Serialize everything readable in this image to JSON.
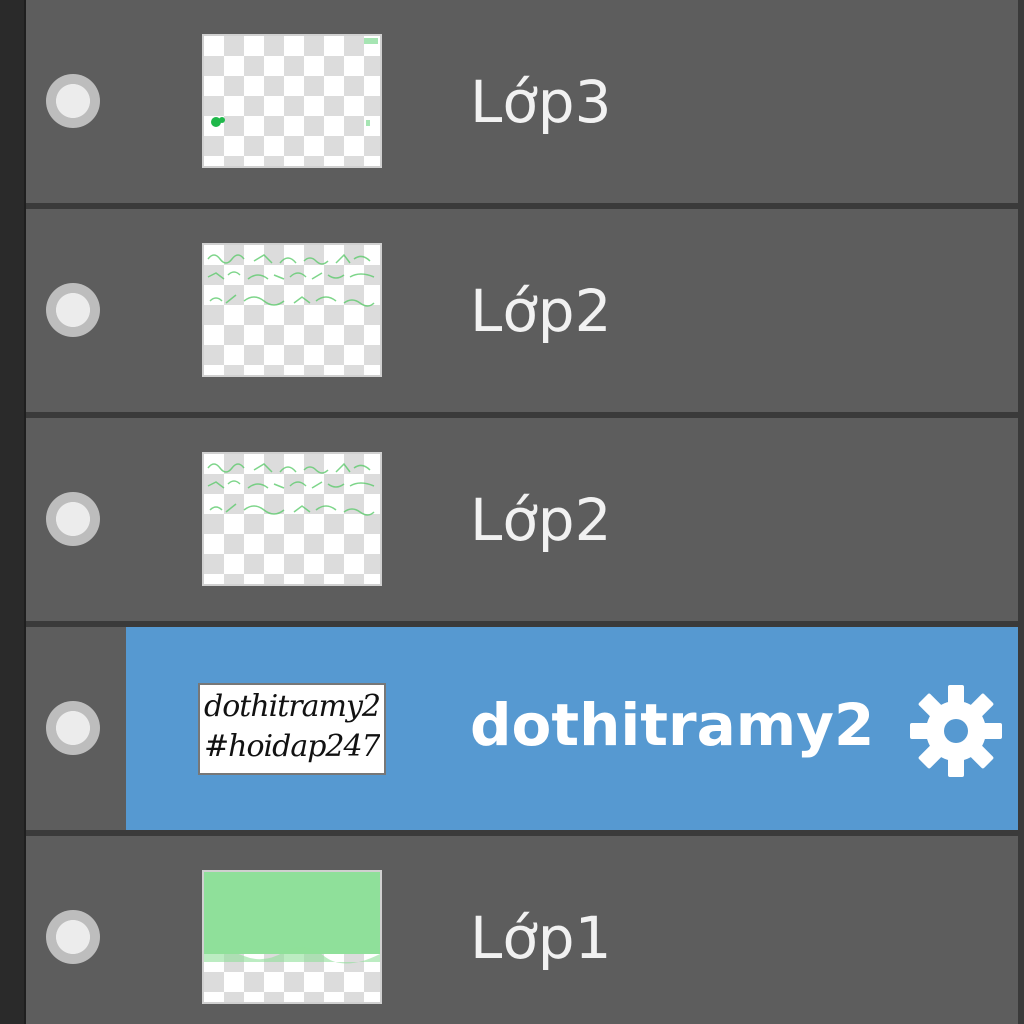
{
  "layers": [
    {
      "name": "Lớp3",
      "visible_icon": "visibility-dot-icon",
      "thumbnail": "transparent-checker-thumb"
    },
    {
      "name": "Lớp2",
      "visible_icon": "visibility-dot-icon",
      "thumbnail": "green-text-thumb"
    },
    {
      "name": "Lớp2",
      "visible_icon": "visibility-dot-icon",
      "thumbnail": "green-text-thumb"
    },
    {
      "name": "dothitramy2",
      "visible_icon": "visibility-dot-icon",
      "thumbnail": "handwritten-text-thumb",
      "selected": true,
      "thumb_text_line1": "dothitramy2",
      "thumb_text_line2": "#hoidap247",
      "settings_icon": "gear-icon"
    },
    {
      "name": "Lớp1",
      "visible_icon": "visibility-dot-icon",
      "thumbnail": "green-fill-thumb"
    }
  ],
  "colors": {
    "row_bg": "#5d5d5d",
    "selected_bg": "#5699d1",
    "separator": "#2b2b2b",
    "text": "#f1f1f1",
    "thumb_green": "#8fe09a"
  }
}
